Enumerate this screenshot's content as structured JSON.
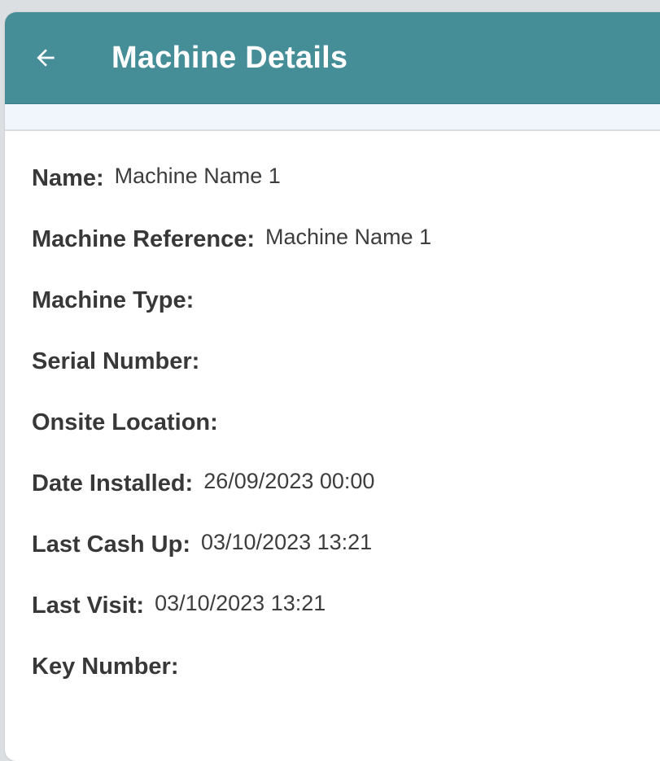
{
  "header": {
    "title": "Machine Details",
    "background_color": "#458e98",
    "back_icon": "arrow-left-icon"
  },
  "details": [
    {
      "label": "Name:",
      "value": "Machine Name 1"
    },
    {
      "label": "Machine Reference:",
      "value": "Machine Name 1"
    },
    {
      "label": "Machine Type:",
      "value": ""
    },
    {
      "label": "Serial Number:",
      "value": ""
    },
    {
      "label": "Onsite Location:",
      "value": ""
    },
    {
      "label": "Date Installed:",
      "value": "26/09/2023 00:00"
    },
    {
      "label": "Last Cash Up:",
      "value": "03/10/2023 13:21"
    },
    {
      "label": "Last Visit:",
      "value": "03/10/2023 13:21"
    },
    {
      "label": "Key Number:",
      "value": ""
    }
  ]
}
